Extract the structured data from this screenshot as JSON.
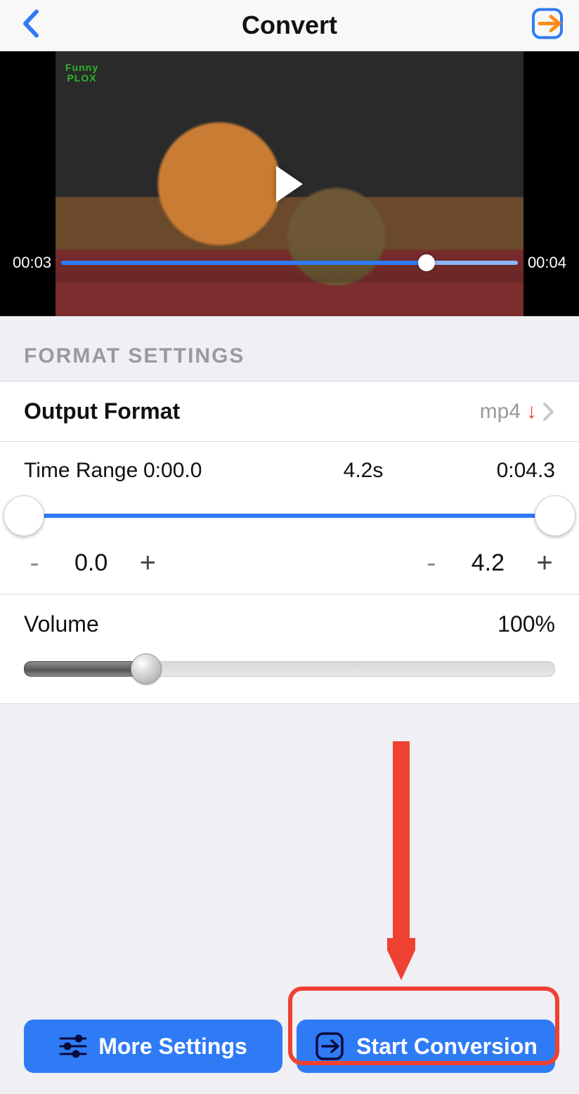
{
  "nav": {
    "title": "Convert"
  },
  "video": {
    "watermark_line1": "Funny",
    "watermark_line2": "PLOX",
    "time_current": "00:03",
    "time_total": "00:04"
  },
  "section_header": "FORMAT SETTINGS",
  "output": {
    "label": "Output Format",
    "value": "mp4"
  },
  "timerange": {
    "label": "Time Range",
    "start": "0:00.0",
    "duration": "4.2s",
    "end": "0:04.3",
    "adj_start": "0.0",
    "adj_end": "4.2"
  },
  "volume": {
    "label": "Volume",
    "value": "100%"
  },
  "buttons": {
    "more": "More Settings",
    "start": "Start Conversion"
  }
}
